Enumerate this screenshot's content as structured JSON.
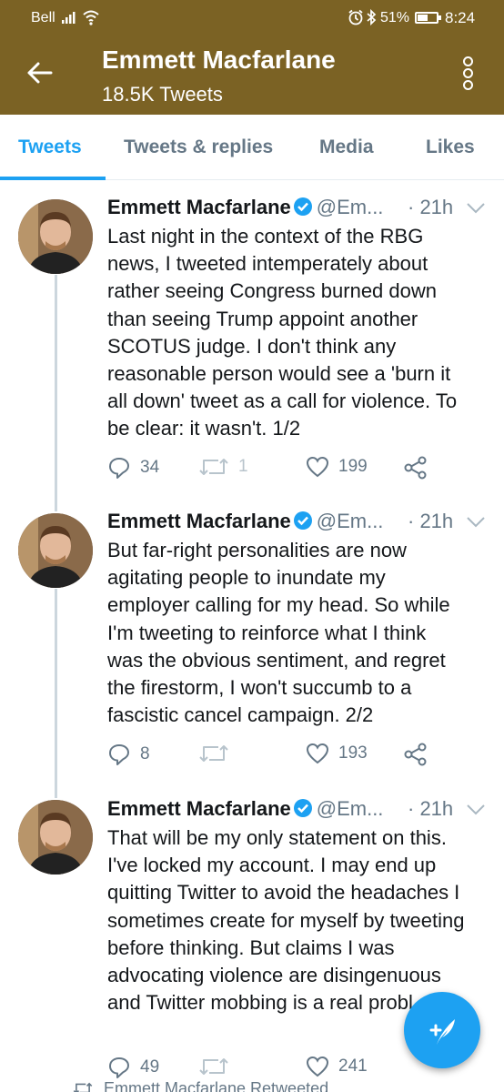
{
  "status_bar": {
    "carrier": "Bell",
    "battery": "51%",
    "time": "8:24"
  },
  "header": {
    "name": "Emmett Macfarlane",
    "tweet_count": "18.5K Tweets"
  },
  "tabs": [
    {
      "label": "Tweets"
    },
    {
      "label": "Tweets & replies"
    },
    {
      "label": "Media"
    },
    {
      "label": "Likes"
    }
  ],
  "tweets": [
    {
      "author": "Emmett Macfarlane",
      "handle": "@Em...",
      "time": "· 21h",
      "lines": [
        "Last night in the context of the RBG",
        "news, I tweeted intemperately about",
        "rather seeing Congress burned down",
        "than seeing Trump appoint another",
        "SCOTUS judge. I don't think any",
        "reasonable person would see a 'burn it",
        "all down' tweet as a call for violence. To",
        "be clear: it wasn't. 1/2"
      ],
      "replies": "34",
      "retweets": "1",
      "likes": "199"
    },
    {
      "author": "Emmett Macfarlane",
      "handle": "@Em...",
      "time": "· 21h",
      "lines": [
        "But far-right personalities are now",
        "agitating people to inundate my",
        "employer calling for my head. So while",
        "I'm tweeting to reinforce what I think",
        "was the obvious sentiment, and regret",
        "the firestorm, I won't succumb to a",
        "fascistic cancel campaign. 2/2"
      ],
      "replies": "8",
      "retweets": "",
      "likes": "193"
    },
    {
      "author": "Emmett Macfarlane",
      "handle": "@Em...",
      "time": "· 21h",
      "lines": [
        "That will be my only statement on this.",
        "I've locked my account. I may end up",
        "quitting Twitter to avoid the headaches I",
        "sometimes create for myself by tweeting",
        "before thinking. But claims I was",
        "advocating violence are disingenuous",
        "and Twitter mobbing is a real probl"
      ],
      "replies": "49",
      "retweets": "",
      "likes": "241"
    }
  ],
  "retweet_note": "Emmett Macfarlane Retweeted",
  "colors": {
    "header_bg": "#7b6224",
    "accent": "#1da1f2",
    "verified": "#1da1f2",
    "muted": "#657786"
  }
}
